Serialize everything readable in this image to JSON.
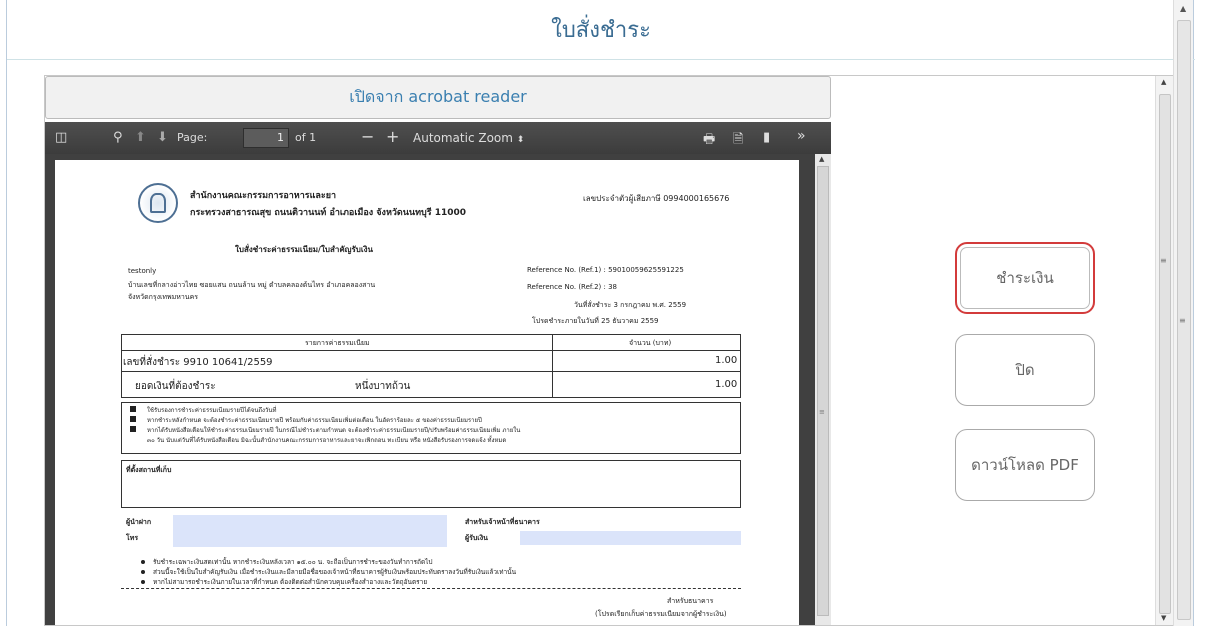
{
  "dialog": {
    "title": "ใบสั่งชำระ"
  },
  "open_acrobat_label": "เปิดจาก acrobat reader",
  "pdf_toolbar": {
    "page_label": "Page:",
    "page_value": "1",
    "page_total": "of 1",
    "zoom": "Automatic Zoom"
  },
  "pdf": {
    "org_line1": "สำนักงานคณะกรรมการอาหารและยา",
    "org_line2": "กระทรวงสาธารณสุข ถนนติวานนท์ อำเภอเมือง จังหวัดนนทบุรี 11000",
    "tax_id": "เลขประจำตัวผู้เสียภาษี 0994000165676",
    "doc_title": "ใบสั่งชำระค่าธรรมเนียม/ใบสำคัญรับเงิน",
    "customer_name": "testonly",
    "address_line1": "บ้านเลขที่กลางอ่าวไทย  ซอยแสน ถนนล้าน หมู่  ตำบลคลองต้นไทร อำเภอคลองสาน",
    "address_line2": "จังหวัดกรุงเทพมหานคร",
    "ref1": "Reference No. (Ref.1) :  59010059625591225",
    "ref2": "Reference No. (Ref.2) :  38",
    "order_date": "วันที่สั่งชำระ   3 กรกฎาคม พ.ศ. 2559",
    "due_date": "โปรดชำระภายในวันที่  25  ธันวาคม  2559",
    "table": {
      "header_item": "รายการค่าธรรมเนียม",
      "header_amount": "จำนวน (บาท)",
      "row_item": "เลขที่สั่งชำระ  9910 10641/2559",
      "row_amount": "1.00",
      "total_label": "ยอดเงินที่ต้องชำระ",
      "total_words": "หนึ่งบาทถ้วน",
      "total_amount": "1.00"
    },
    "notes": [
      "ใช้รับรองการชำระค่าธรรมเนียมรายปีได้จนถึงวันที่",
      "หากชำระหลังกำหนด จะต้องชำระค่าธรรมเนียมรายปี พร้อมกับค่าธรรมเนียมเพิ่มต่อเดือน ในอัตราร้อยละ ๕ ของค่าธรรมเนียมรายปี",
      "หากได้รับหนังสือเตือนให้ชำระค่าธรรมเนียมรายปี ในกรณีไม่ชำระตามกำหนด จะต้องชำระค่าธรรมเนียมรายปี/ปรับพร้อมค่าธรรมเนียมเพิ่ม ภายใน",
      "๓๐ วัน นับแต่วันที่ได้รับหนังสือเตือน มิฉะนั้นสำนักงานคณะกรรมการอาหารและยาจะเพิกถอน ทะเบียน หรือ หนังสือรับรองการจดแจ้ง ทั้งหมด"
    ],
    "location_label": "ที่ตั้งสถานที่เก็บ",
    "depositor_label": "ผู้นำฝาก",
    "phone_label": "โทร",
    "bank_label": "สำหรับเจ้าหน้าที่ธนาคาร",
    "receiver_label": "ผู้รับเงิน",
    "footer_notes": [
      "รับชำระเฉพาะเงินสดเท่านั้น หากชำระเงินหลังเวลา ๑๕.๐๐ น. จะถือเป็นการชำระของวันทำการถัดไป",
      "ส่วนนี้จะใช้เป็นใบสำคัญรับเงิน เมื่อชำระเงินและมีลายมือชื่อของเจ้าหน้าที่ธนาคารผู้รับเงินพร้อมประทับตราลงวันที่รับเงินแล้วเท่านั้น",
      "หากไม่สามารถชำระเงินภายในเวลาที่กำหนด ต้องติดต่อสำนักควบคุมเครื่องสำอางและวัตถุอันตราย"
    ],
    "bank_copy": "สำหรับธนาคาร",
    "bank_copy_note": "(โปรดเรียกเก็บค่าธรรมเนียมจากผู้ชำระเงิน)"
  },
  "buttons": {
    "pay": "ชำระเงิน",
    "close": "ปิด",
    "download": "ดาวน์โหลด PDF"
  },
  "colors": {
    "title": "#3a6c92",
    "pay_border": "#d33b3b",
    "field_fill": "#dbe4fa"
  }
}
